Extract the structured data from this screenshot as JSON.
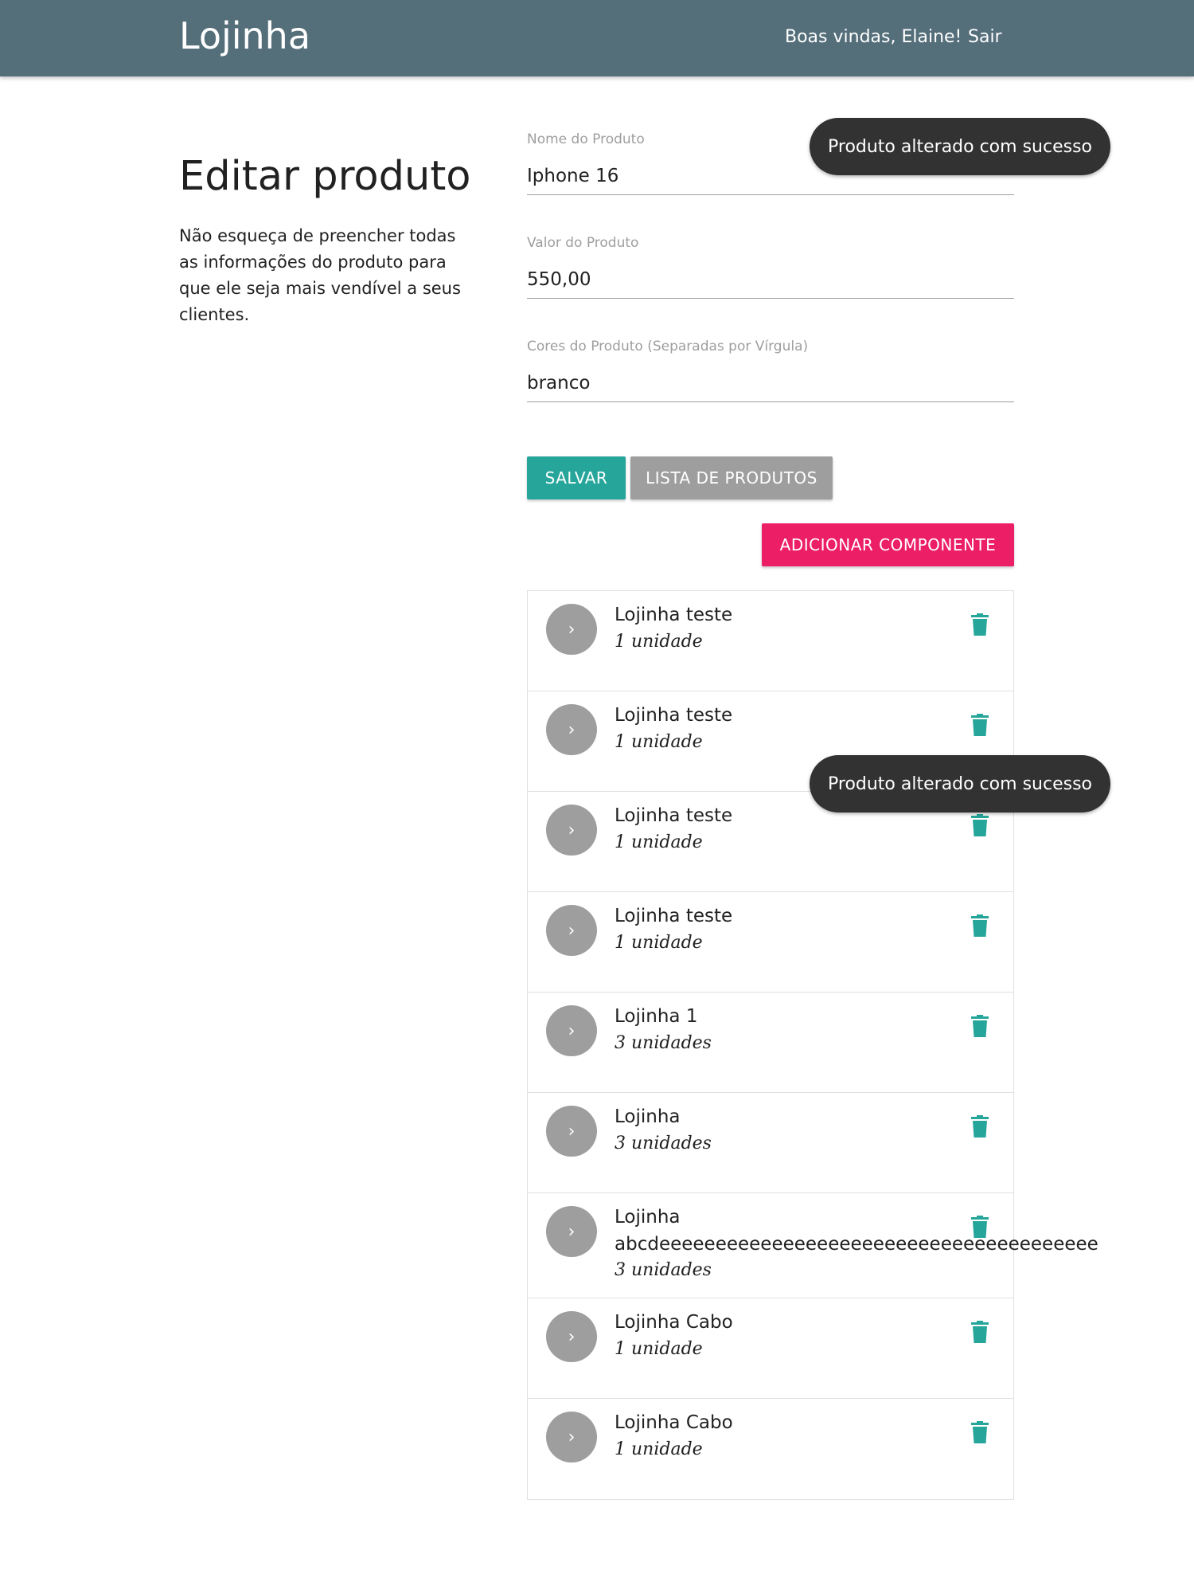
{
  "header": {
    "brand": "Lojinha",
    "welcome": "Boas vindas, Elaine!",
    "logout": "Sair"
  },
  "page": {
    "title": "Editar produto",
    "description": "Não esqueça de preencher todas as informações do produto para que ele seja mais vendível a seus clientes."
  },
  "form": {
    "name_label": "Nome do Produto",
    "name_value": "Iphone 16",
    "price_label": "Valor do Produto",
    "price_value": "550,00",
    "colors_label": "Cores do Produto (Separadas por Vírgula)",
    "colors_value": "branco",
    "save_label": "Salvar",
    "list_label": "Lista de produtos",
    "add_label": "Adicionar componente"
  },
  "components": [
    {
      "name": "Lojinha teste",
      "qty": "1 unidade"
    },
    {
      "name": "Lojinha teste",
      "qty": "1 unidade"
    },
    {
      "name": "Lojinha teste",
      "qty": "1 unidade"
    },
    {
      "name": "Lojinha teste",
      "qty": "1 unidade"
    },
    {
      "name": "Lojinha 1",
      "qty": "3 unidades"
    },
    {
      "name": "Lojinha",
      "qty": "3 unidades"
    },
    {
      "name": "Lojinha",
      "extra": "abcdeeeeeeeeeeeeeeeeeeeeeeeeeeeeeeeeeeeeeee",
      "qty": "3 unidades"
    },
    {
      "name": "Lojinha Cabo",
      "qty": "1 unidade"
    },
    {
      "name": "Lojinha Cabo",
      "qty": "1 unidade"
    }
  ],
  "toasts": [
    "Produto alterado com sucesso",
    "Produto alterado com sucesso"
  ],
  "icons": {
    "chevron": "chevron-right-icon",
    "trash": "trash-icon"
  },
  "colors": {
    "navbar": "#546e7a",
    "teal": "#26a69a",
    "grey": "#9e9e9e",
    "pink": "#ec1f66",
    "toast": "#323232"
  }
}
